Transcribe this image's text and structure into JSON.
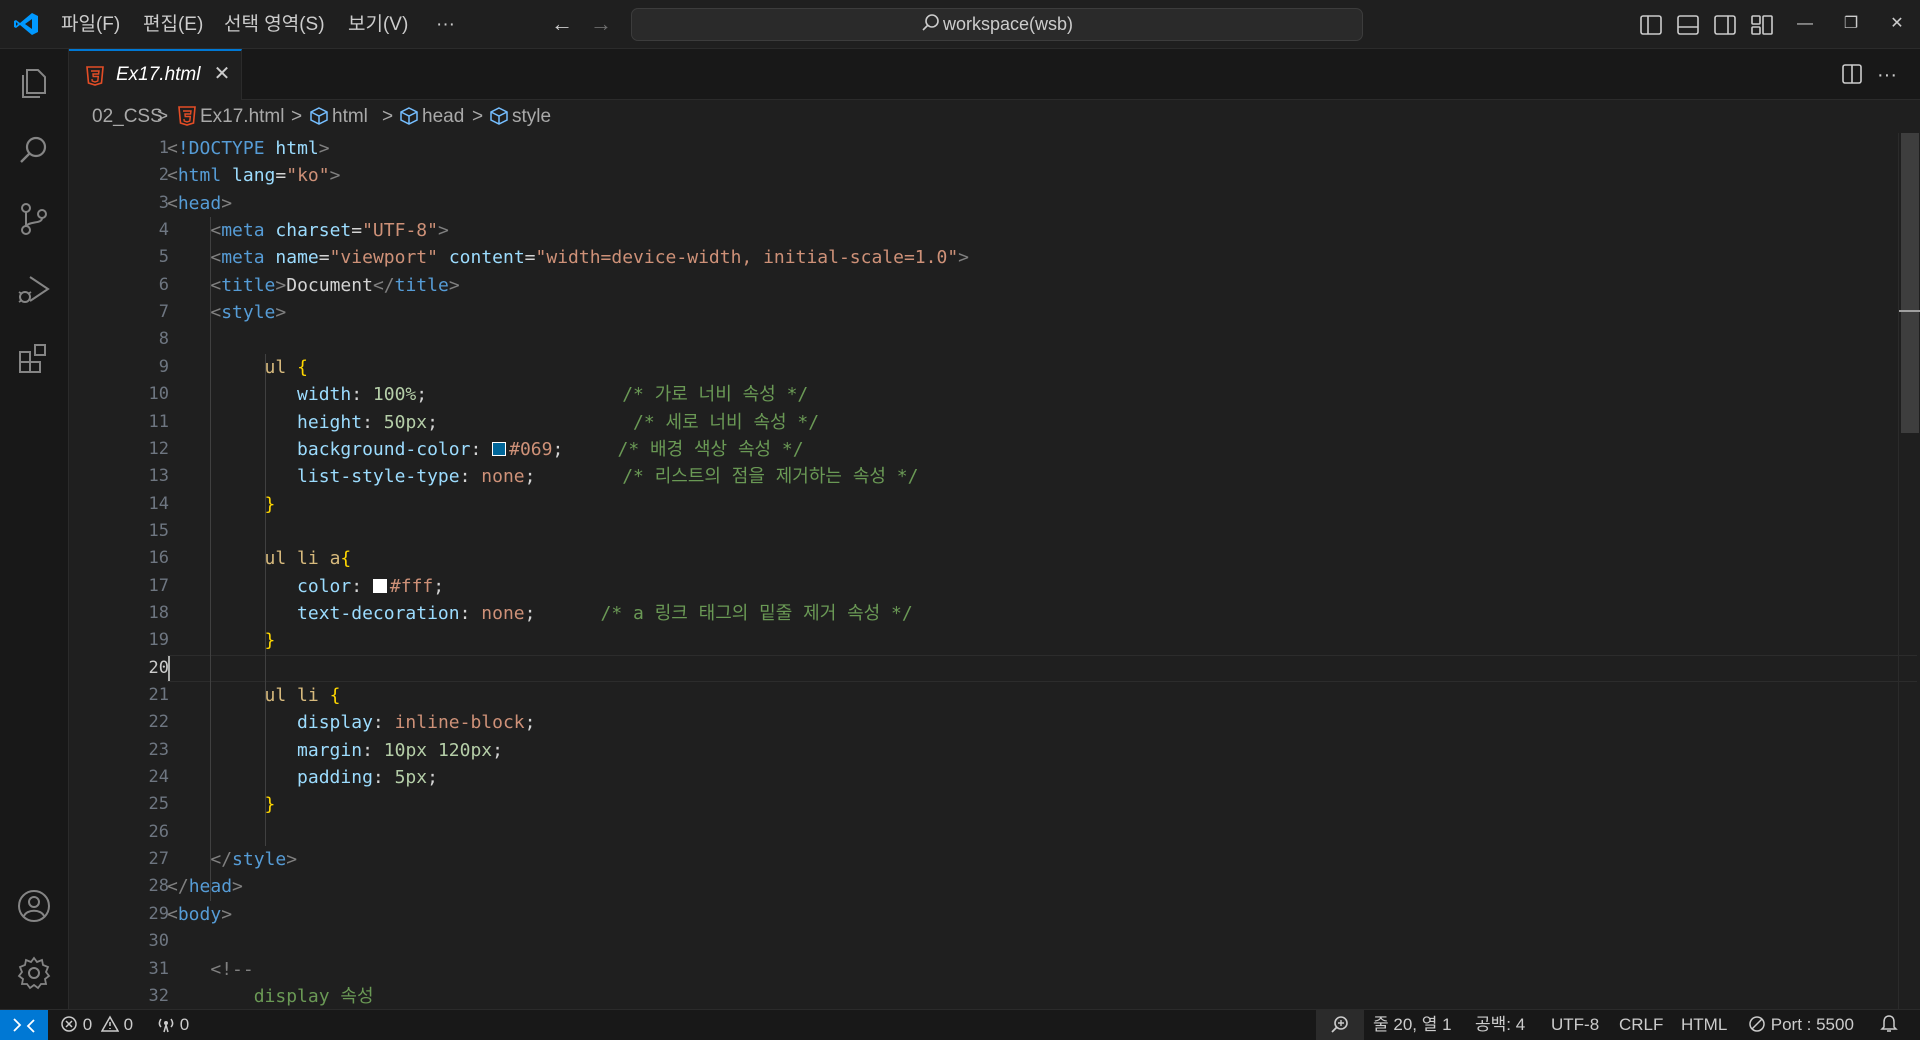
{
  "titlebar": {
    "menus": [
      "파일(F)",
      "편집(E)",
      "선택 영역(S)",
      "보기(V)",
      "···"
    ],
    "search_text": "workspace(wsb)",
    "back_arrow": "←",
    "forward_arrow": "→",
    "minimize": "—",
    "restore": "❐",
    "close": "✕"
  },
  "tabs": [
    {
      "label": "Ex17.html",
      "icon": "html5-icon",
      "close": "✕"
    }
  ],
  "tab_actions": {
    "more": "···"
  },
  "breadcrumb": {
    "items": [
      "02_CSS",
      "Ex17.html",
      "html",
      "head",
      "style"
    ],
    "separator": ">"
  },
  "editor": {
    "active_line": 20,
    "line_numbers": [
      "1",
      "2",
      "3",
      "4",
      "5",
      "6",
      "7",
      "8",
      "9",
      "10",
      "11",
      "12",
      "13",
      "14",
      "15",
      "16",
      "17",
      "18",
      "19",
      "20",
      "21",
      "22",
      "23",
      "24",
      "25",
      "26",
      "27",
      "28",
      "29",
      "30",
      "31",
      "32"
    ],
    "lines": [
      [
        [
          "br",
          "<"
        ],
        [
          "tag",
          "!DOCTYPE "
        ],
        [
          "attr",
          "html"
        ],
        [
          "br",
          ">"
        ]
      ],
      [
        [
          "br",
          "<"
        ],
        [
          "tag",
          "html "
        ],
        [
          "attr",
          "lang"
        ],
        [
          "txt",
          "="
        ],
        [
          "str",
          "\"ko\""
        ],
        [
          "br",
          ">"
        ]
      ],
      [
        [
          "br",
          "<"
        ],
        [
          "tag",
          "head"
        ],
        [
          "br",
          ">"
        ]
      ],
      [
        [
          "txt",
          "    "
        ],
        [
          "br",
          "<"
        ],
        [
          "tag",
          "meta "
        ],
        [
          "attr",
          "charset"
        ],
        [
          "txt",
          "="
        ],
        [
          "str",
          "\"UTF-8\""
        ],
        [
          "br",
          ">"
        ]
      ],
      [
        [
          "txt",
          "    "
        ],
        [
          "br",
          "<"
        ],
        [
          "tag",
          "meta "
        ],
        [
          "attr",
          "name"
        ],
        [
          "txt",
          "="
        ],
        [
          "str",
          "\"viewport\" "
        ],
        [
          "attr",
          "content"
        ],
        [
          "txt",
          "="
        ],
        [
          "str",
          "\"width=device-width, initial-scale=1.0\""
        ],
        [
          "br",
          ">"
        ]
      ],
      [
        [
          "txt",
          "    "
        ],
        [
          "br",
          "<"
        ],
        [
          "tag",
          "title"
        ],
        [
          "br",
          ">"
        ],
        [
          "txt",
          "Document"
        ],
        [
          "br",
          "</"
        ],
        [
          "tag",
          "title"
        ],
        [
          "br",
          ">"
        ]
      ],
      [
        [
          "txt",
          "    "
        ],
        [
          "br",
          "<"
        ],
        [
          "tag",
          "style"
        ],
        [
          "br",
          ">"
        ]
      ],
      [],
      [
        [
          "txt",
          "         "
        ],
        [
          "sel",
          "ul "
        ],
        [
          "brace",
          "{"
        ]
      ],
      [
        [
          "txt",
          "            "
        ],
        [
          "prop",
          "width"
        ],
        [
          "txt",
          ": "
        ],
        [
          "num",
          "100%"
        ],
        [
          "txt",
          ";                  "
        ],
        [
          "cmt",
          "/* 가로 너비 속성 */"
        ]
      ],
      [
        [
          "txt",
          "            "
        ],
        [
          "prop",
          "height"
        ],
        [
          "txt",
          ": "
        ],
        [
          "num",
          "50px"
        ],
        [
          "txt",
          ";                  "
        ],
        [
          "cmt",
          "/* 세로 너비 속성 */"
        ]
      ],
      [
        [
          "txt",
          "            "
        ],
        [
          "prop",
          "background-color"
        ],
        [
          "txt",
          ": "
        ],
        [
          "swatch",
          "#006699"
        ],
        [
          "val",
          "#069"
        ],
        [
          "txt",
          ";     "
        ],
        [
          "cmt",
          "/* 배경 색상 속성 */"
        ]
      ],
      [
        [
          "txt",
          "            "
        ],
        [
          "prop",
          "list-style-type"
        ],
        [
          "txt",
          ": "
        ],
        [
          "val",
          "none"
        ],
        [
          "txt",
          ";        "
        ],
        [
          "cmt",
          "/* 리스트의 점을 제거하는 속성 */"
        ]
      ],
      [
        [
          "txt",
          "         "
        ],
        [
          "brace",
          "}"
        ]
      ],
      [],
      [
        [
          "txt",
          "         "
        ],
        [
          "sel",
          "ul li a"
        ],
        [
          "brace",
          "{"
        ]
      ],
      [
        [
          "txt",
          "            "
        ],
        [
          "prop",
          "color"
        ],
        [
          "txt",
          ": "
        ],
        [
          "swatch",
          "#ffffff"
        ],
        [
          "val",
          "#fff"
        ],
        [
          "txt",
          ";"
        ]
      ],
      [
        [
          "txt",
          "            "
        ],
        [
          "prop",
          "text-decoration"
        ],
        [
          "txt",
          ": "
        ],
        [
          "val",
          "none"
        ],
        [
          "txt",
          ";      "
        ],
        [
          "cmt",
          "/* a 링크 태그의 밑줄 제거 속성 */"
        ]
      ],
      [
        [
          "txt",
          "         "
        ],
        [
          "brace",
          "}"
        ]
      ],
      [],
      [
        [
          "txt",
          "         "
        ],
        [
          "sel",
          "ul li "
        ],
        [
          "brace",
          "{"
        ]
      ],
      [
        [
          "txt",
          "            "
        ],
        [
          "prop",
          "display"
        ],
        [
          "txt",
          ": "
        ],
        [
          "val",
          "inline-block"
        ],
        [
          "txt",
          ";"
        ]
      ],
      [
        [
          "txt",
          "            "
        ],
        [
          "prop",
          "margin"
        ],
        [
          "txt",
          ": "
        ],
        [
          "num",
          "10px 120px"
        ],
        [
          "txt",
          ";"
        ]
      ],
      [
        [
          "txt",
          "            "
        ],
        [
          "prop",
          "padding"
        ],
        [
          "txt",
          ": "
        ],
        [
          "num",
          "5px"
        ],
        [
          "txt",
          ";"
        ]
      ],
      [
        [
          "txt",
          "         "
        ],
        [
          "brace",
          "}"
        ]
      ],
      [],
      [
        [
          "txt",
          "    "
        ],
        [
          "br",
          "</"
        ],
        [
          "tag",
          "style"
        ],
        [
          "br",
          ">"
        ]
      ],
      [
        [
          "br",
          "</"
        ],
        [
          "tag",
          "head"
        ],
        [
          "br",
          ">"
        ]
      ],
      [
        [
          "br",
          "<"
        ],
        [
          "tag",
          "body"
        ],
        [
          "br",
          ">"
        ]
      ],
      [],
      [
        [
          "txt",
          "    "
        ],
        [
          "br",
          "<!--"
        ]
      ],
      [
        [
          "txt",
          "        "
        ],
        [
          "cmt",
          "display 속성"
        ]
      ]
    ]
  },
  "statusbar": {
    "errors": "0",
    "warnings": "0",
    "ports": "0",
    "position": "줄 20, 열 1",
    "indent": "공백: 4",
    "encoding": "UTF-8",
    "eol": "CRLF",
    "language": "HTML",
    "live_server": "Port : 5500"
  },
  "colors": {
    "accent": "#0078d4",
    "html_icon": "#e44d26",
    "editor_bg": "#1f1f1f"
  }
}
